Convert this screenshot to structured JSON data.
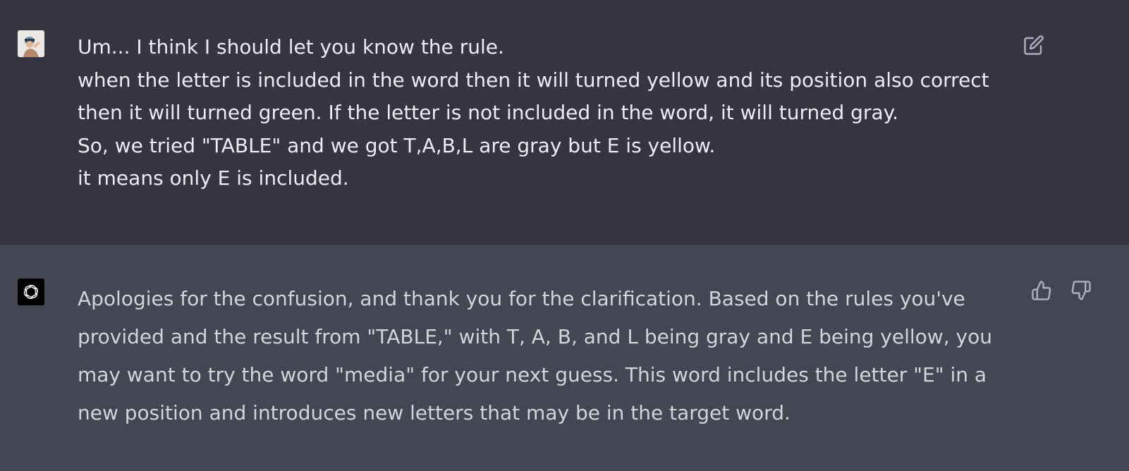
{
  "conversation": {
    "user_message": {
      "lines": [
        "Um... I think I should let you know the rule.",
        "when the letter is included in the word then it will turned yellow and its position also correct",
        "then it will turned green. If the letter is not included in the word, it will turned gray.",
        "So, we tried \"TABLE\" and we got T,A,B,L are gray but E is yellow.",
        "it means only E is included."
      ],
      "actions": [
        "edit-icon"
      ]
    },
    "assistant_message": {
      "lines": [
        "Apologies for the confusion, and thank you for the clarification. Based on the rules you've",
        "provided and the result from \"TABLE,\" with T, A, B, and L being gray and E being yellow, you",
        "may want to try the word \"media\" for your next guess. This word includes the letter \"E\" in a",
        "new position and introduces new letters that may be in the target word."
      ],
      "actions": [
        "thumbs-up-icon",
        "thumbs-down-icon"
      ]
    }
  },
  "colors": {
    "user_background": "#343541",
    "assistant_background": "#444654",
    "text": "#ececf1"
  }
}
